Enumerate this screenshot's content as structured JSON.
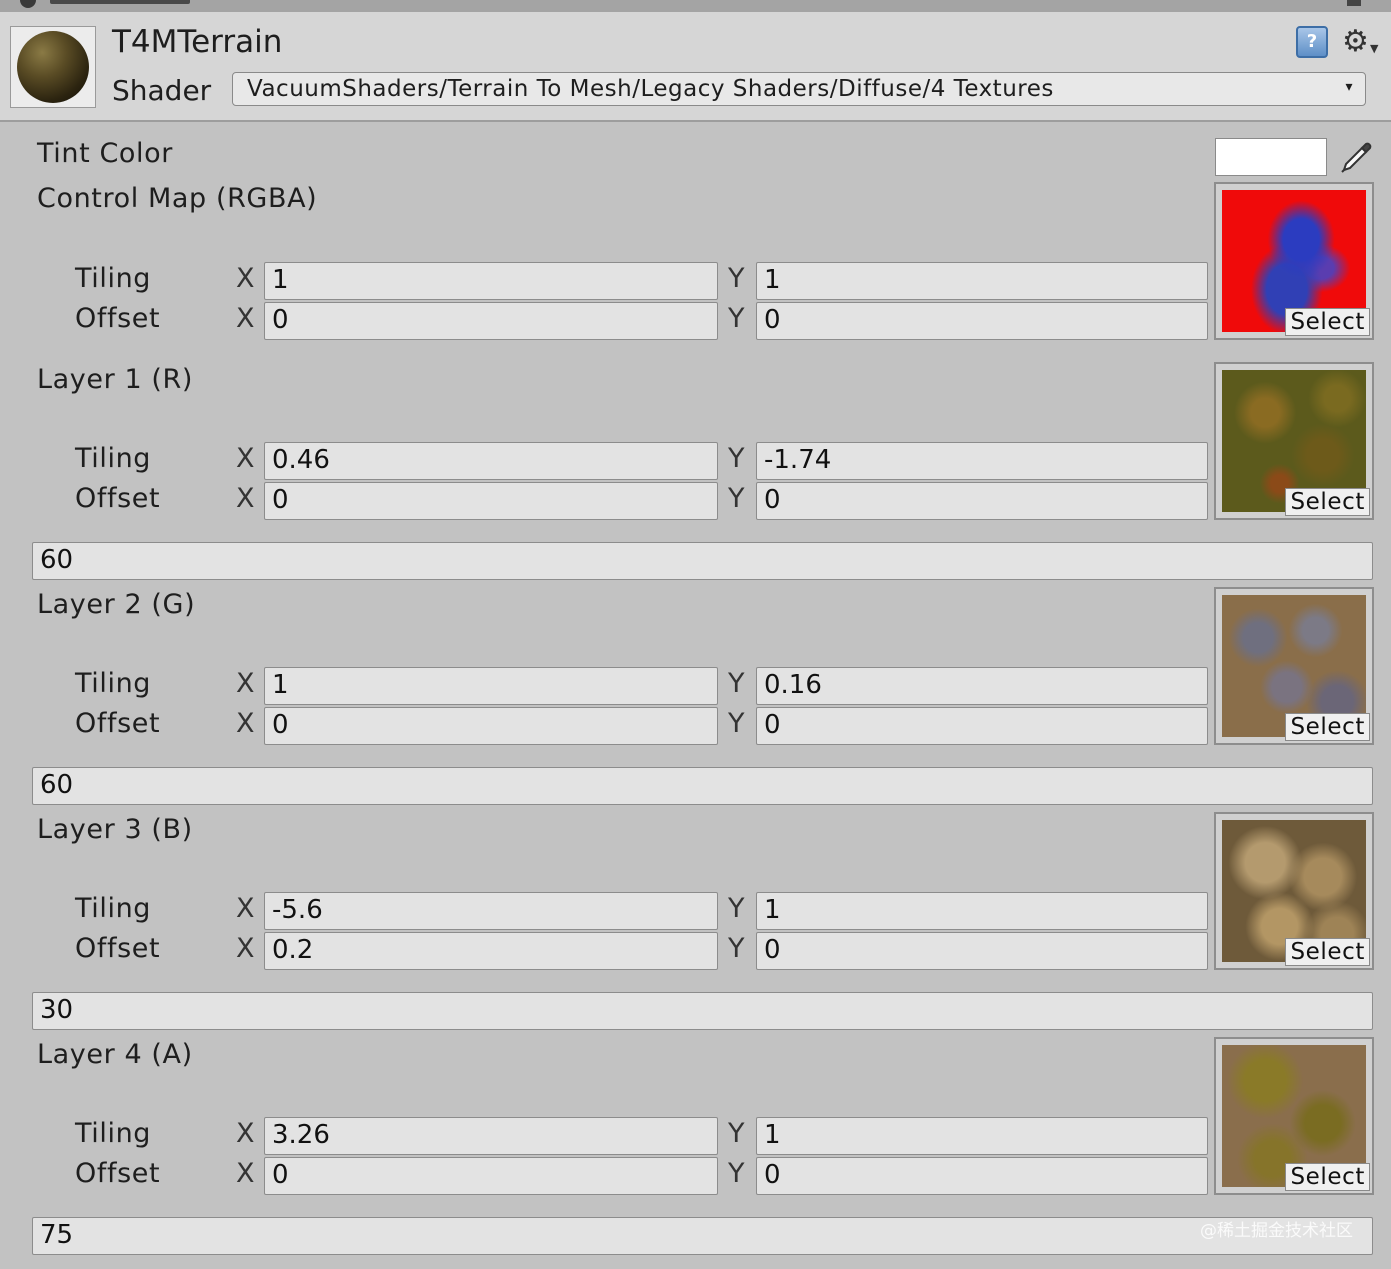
{
  "header": {
    "material_name": "T4MTerrain",
    "shader_label": "Shader",
    "shader_value": "VacuumShaders/Terrain To Mesh/Legacy Shaders/Diffuse/4 Textures",
    "help_icon_glyph": "?",
    "gear_icon_glyph": "⚙",
    "dropdown_arrow": "▾"
  },
  "properties": {
    "tint_color_label": "Tint Color",
    "tint_color_value": "#ffffff",
    "control_map": {
      "label": "Control Map (RGBA)",
      "tiling_label": "Tiling",
      "offset_label": "Offset",
      "tiling_x": "1",
      "tiling_y": "1",
      "offset_x": "0",
      "offset_y": "0",
      "select_label": "Select"
    },
    "layer1": {
      "label": "Layer 1 (R)",
      "tiling_label": "Tiling",
      "offset_label": "Offset",
      "tiling_x": "0.46",
      "tiling_y": "-1.74",
      "offset_x": "0",
      "offset_y": "0",
      "select_label": "Select",
      "value": "60"
    },
    "layer2": {
      "label": "Layer 2 (G)",
      "tiling_label": "Tiling",
      "offset_label": "Offset",
      "tiling_x": "1",
      "tiling_y": "0.16",
      "offset_x": "0",
      "offset_y": "0",
      "select_label": "Select",
      "value": "60"
    },
    "layer3": {
      "label": "Layer 3 (B)",
      "tiling_label": "Tiling",
      "offset_label": "Offset",
      "tiling_x": "-5.6",
      "tiling_y": "1",
      "offset_x": "0.2",
      "offset_y": "0",
      "select_label": "Select",
      "value": "30"
    },
    "layer4": {
      "label": "Layer 4 (A)",
      "tiling_label": "Tiling",
      "offset_label": "Offset",
      "tiling_x": "3.26",
      "tiling_y": "1",
      "offset_x": "0",
      "offset_y": "0",
      "select_label": "Select",
      "value": "75"
    }
  },
  "axis": {
    "x": "X",
    "y": "Y"
  },
  "watermark": "@稀土掘金技术社区"
}
